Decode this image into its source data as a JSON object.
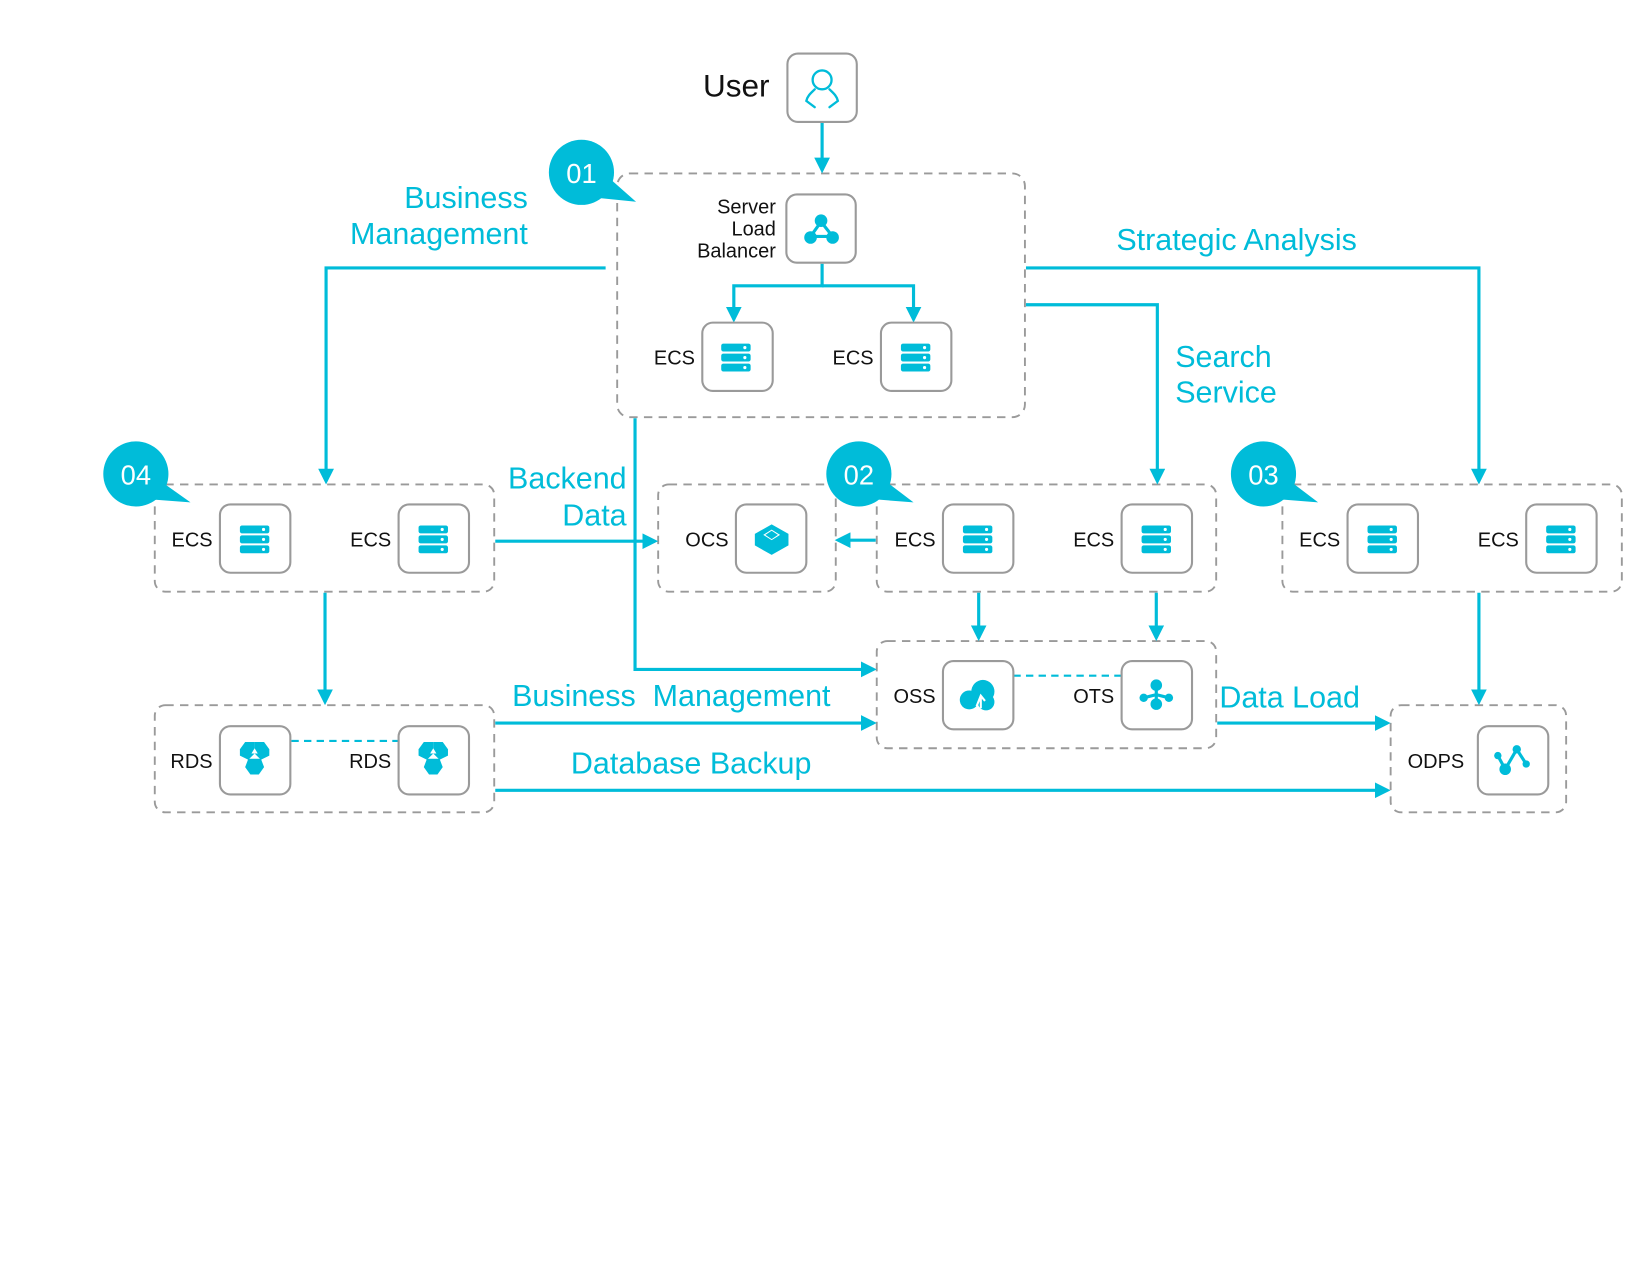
{
  "colors": {
    "accent": "#00BCD9",
    "border": "#9a9a9a",
    "text": "#111111"
  },
  "user": {
    "label": "User",
    "icon": "user-icon"
  },
  "groups": {
    "g01": {
      "badge": "01",
      "slb_label": [
        "Server",
        "Load",
        "Balancer"
      ],
      "nodes": [
        {
          "label": "ECS",
          "icon": "server-icon"
        },
        {
          "label": "ECS",
          "icon": "server-icon"
        }
      ]
    },
    "g04": {
      "badge": "04",
      "nodes": [
        {
          "label": "ECS",
          "icon": "server-icon"
        },
        {
          "label": "ECS",
          "icon": "server-icon"
        }
      ]
    },
    "ocs": {
      "nodes": [
        {
          "label": "OCS",
          "icon": "cache-icon"
        }
      ]
    },
    "g02": {
      "badge": "02",
      "nodes": [
        {
          "label": "ECS",
          "icon": "server-icon"
        },
        {
          "label": "ECS",
          "icon": "server-icon"
        }
      ]
    },
    "g03": {
      "badge": "03",
      "nodes": [
        {
          "label": "ECS",
          "icon": "server-icon"
        },
        {
          "label": "ECS",
          "icon": "server-icon"
        }
      ]
    },
    "rds": {
      "nodes": [
        {
          "label": "RDS",
          "icon": "database-icon"
        },
        {
          "label": "RDS",
          "icon": "database-icon"
        }
      ]
    },
    "storage": {
      "nodes": [
        {
          "label": "OSS",
          "icon": "cloud-upload-icon"
        },
        {
          "label": "OTS",
          "icon": "table-store-icon"
        }
      ]
    },
    "odps": {
      "nodes": [
        {
          "label": "ODPS",
          "icon": "analytics-icon"
        }
      ]
    }
  },
  "flows": {
    "business_management_top": [
      "Business",
      "Management"
    ],
    "strategic_analysis": "Strategic Analysis",
    "search_service": [
      "Search",
      "Service"
    ],
    "backend_data": [
      "Backend",
      "Data"
    ],
    "business_management_bottom": "Business  Management",
    "database_backup": "Database Backup",
    "data_load": "Data Load"
  }
}
